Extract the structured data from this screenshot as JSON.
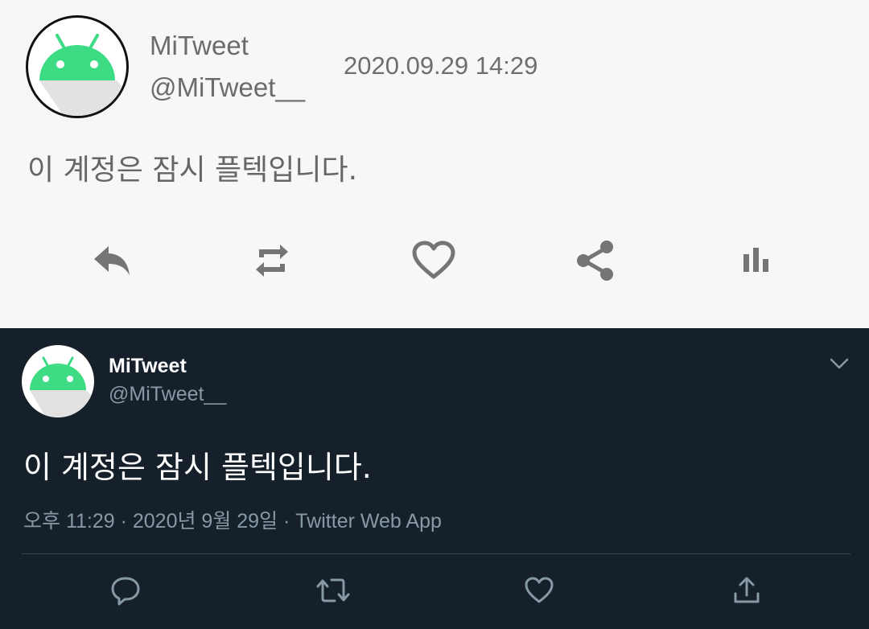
{
  "light_tweet": {
    "display_name": "MiTweet",
    "handle": "@MiTweet__",
    "timestamp": "2020.09.29 14:29",
    "text": "이 계정은 잠시 플텍입니다.",
    "actions": [
      "reply-icon",
      "retweet-icon",
      "like-icon",
      "share-icon",
      "stats-icon"
    ],
    "colors": {
      "background": "#f7f7f7",
      "text": "#666666",
      "icon": "#757575",
      "avatar_green": "#3ddc84"
    }
  },
  "dark_tweet": {
    "display_name": "MiTweet",
    "handle": "@MiTweet__",
    "text": "이 계정은 잠시 플텍입니다.",
    "meta": "오후 11:29 · 2020년 9월 29일 · Twitter Web App",
    "actions": [
      "reply-icon",
      "retweet-icon",
      "like-icon",
      "share-icon"
    ],
    "colors": {
      "background": "#15202b",
      "text": "#ffffff",
      "secondary": "#8899a6",
      "divider": "#38444d"
    }
  }
}
